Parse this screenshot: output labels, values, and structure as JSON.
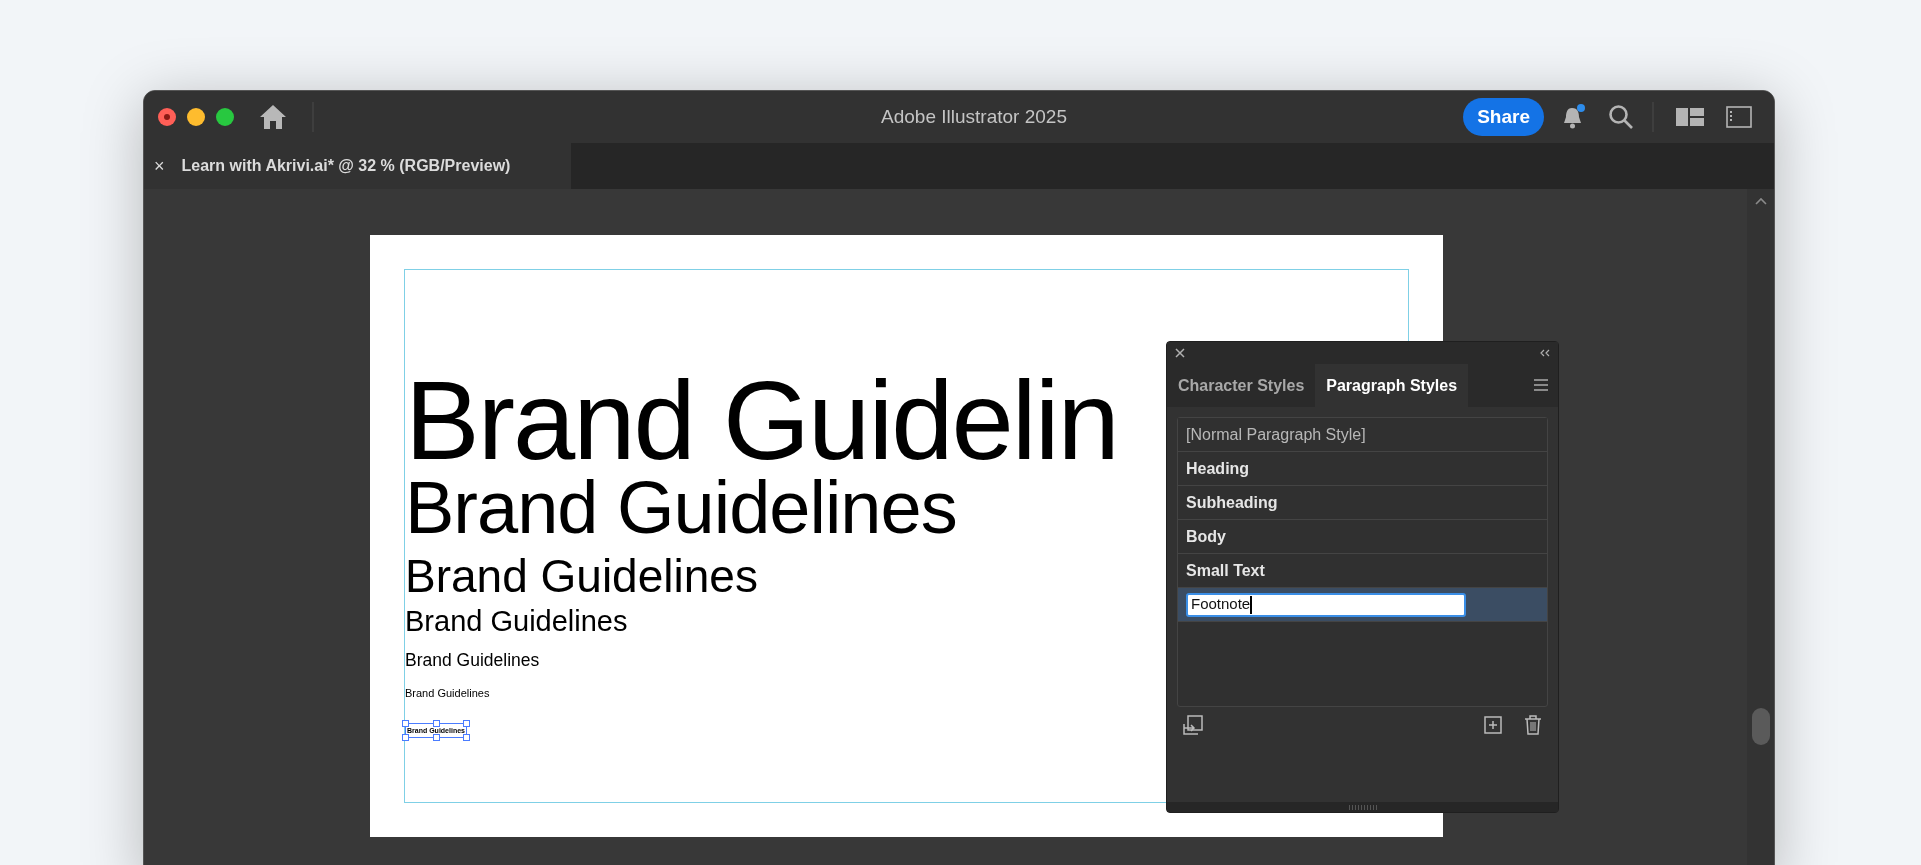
{
  "window": {
    "title": "Adobe Illustrator 2025",
    "share_button": "Share"
  },
  "document_tab": {
    "close": "×",
    "label": "Learn with Akrivi.ai* @ 32 % (RGB/Preview)"
  },
  "artboard": {
    "text_lines": [
      {
        "text": "Brand Guidelin",
        "selected": false
      },
      {
        "text": "Brand Guidelines",
        "selected": false
      },
      {
        "text": "Brand Guidelines",
        "selected": false
      },
      {
        "text": "Brand Guidelines",
        "selected": false
      },
      {
        "text": "Brand Guidelines",
        "selected": false
      },
      {
        "text": "Brand Guidelines",
        "selected": false
      },
      {
        "text": "Brand Guidelines",
        "selected": true
      }
    ]
  },
  "styles_panel": {
    "tabs": [
      {
        "label": "Character Styles",
        "selected": false
      },
      {
        "label": "Paragraph Styles",
        "selected": true
      }
    ],
    "styles": [
      {
        "name": "[Normal Paragraph Style]",
        "kind": "default",
        "selected": false
      },
      {
        "name": "Heading",
        "kind": "style",
        "selected": false
      },
      {
        "name": "Subheading",
        "kind": "style",
        "selected": false
      },
      {
        "name": "Body",
        "kind": "style",
        "selected": false
      },
      {
        "name": "Small Text",
        "kind": "style",
        "selected": false
      },
      {
        "name": "Footnote",
        "kind": "editing",
        "selected": true
      }
    ]
  }
}
